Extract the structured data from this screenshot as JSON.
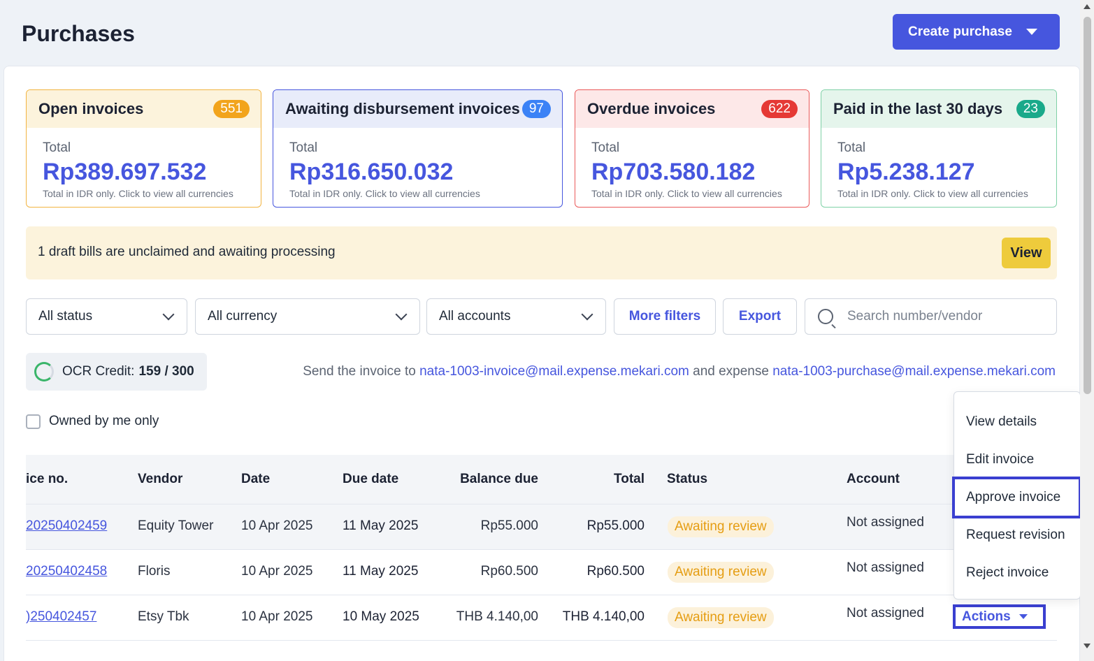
{
  "page": {
    "title": "Purchases"
  },
  "header": {
    "create_button": "Create purchase"
  },
  "summary_cards": [
    {
      "title": "Open invoices",
      "count": "551",
      "total_label": "Total",
      "amount": "Rp389.697.532",
      "note": "Total in IDR only. Click to view all currencies",
      "accent": "#f2a41c",
      "bg": "#fcf3dc"
    },
    {
      "title": "Awaiting disbursement invoices",
      "count": "97",
      "total_label": "Total",
      "amount": "Rp316.650.032",
      "note": "Total in IDR only. Click to view all currencies",
      "accent": "#3b82f6",
      "bg": "#e8ecfa"
    },
    {
      "title": "Overdue invoices",
      "count": "622",
      "total_label": "Total",
      "amount": "Rp703.580.182",
      "note": "Total in IDR only. Click to view all currencies",
      "accent": "#e53935",
      "bg": "#fde8e8"
    },
    {
      "title": "Paid in the last 30 days",
      "count": "23",
      "total_label": "Total",
      "amount": "Rp5.238.127",
      "note": "Total in IDR only. Click to view all currencies",
      "accent": "#1aa98a",
      "bg": "#e5f5ec"
    }
  ],
  "banner": {
    "text": "1 draft bills are unclaimed and awaiting processing",
    "button": "View"
  },
  "filters": {
    "status": "All status",
    "currency": "All currency",
    "accounts": "All accounts",
    "more_filters": "More filters",
    "export": "Export",
    "search_placeholder": "Search number/vendor"
  },
  "ocr": {
    "label": "OCR Credit:",
    "value": "159 / 300"
  },
  "send_line": {
    "prefix": "Send the invoice to",
    "invoice_email": "nata-1003-invoice@mail.expense.mekari.com",
    "middle": "and expense",
    "purchase_email": "nata-1003-purchase@mail.expense.mekari.com"
  },
  "owned_filter": {
    "label": "Owned by me only"
  },
  "table": {
    "headers": {
      "invoice_no": "ice no.",
      "vendor": "Vendor",
      "date": "Date",
      "due_date": "Due date",
      "balance_due": "Balance due",
      "total": "Total",
      "status": "Status",
      "account": "Account"
    },
    "rows": [
      {
        "invoice_no": "20250402459",
        "vendor": "Equity Tower",
        "date": "10 Apr 2025",
        "due_date": "11 May 2025",
        "balance_due": "Rp55.000",
        "total": "Rp55.000",
        "status": "Awaiting review",
        "account": "Not assigned"
      },
      {
        "invoice_no": "20250402458",
        "vendor": "Floris",
        "date": "10 Apr 2025",
        "due_date": "11 May 2025",
        "balance_due": "Rp60.500",
        "total": "Rp60.500",
        "status": "Awaiting review",
        "account": "Not assigned"
      },
      {
        "invoice_no": ")250402457",
        "vendor": "Etsy Tbk",
        "date": "10 Apr 2025",
        "due_date": "10 May 2025",
        "balance_due": "THB 4.140,00",
        "total": "THB 4.140,00",
        "status": "Awaiting review",
        "account": "Not assigned"
      }
    ]
  },
  "actions_button": "Actions",
  "actions_menu": [
    "View details",
    "Edit invoice",
    "Approve invoice",
    "Request revision",
    "Reject invoice"
  ]
}
